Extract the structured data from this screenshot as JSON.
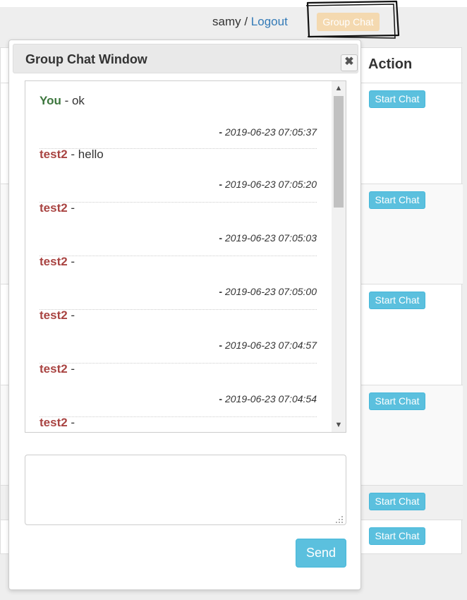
{
  "header": {
    "username": "samy",
    "separator": " / ",
    "logout_label": "Logout",
    "group_chat_label": "Group Chat"
  },
  "table": {
    "action_header": "Action",
    "start_chat_label": "Start Chat"
  },
  "dialog": {
    "title": "Group Chat Window",
    "close_icon": "close-icon",
    "messages": [
      {
        "sender": "You",
        "text": "ok",
        "time": "2019-06-23 07:05:37"
      },
      {
        "sender": "test2",
        "text": "hello",
        "time": "2019-06-23 07:05:20"
      },
      {
        "sender": "test2",
        "text": "",
        "time": "2019-06-23 07:05:03"
      },
      {
        "sender": "test2",
        "text": "",
        "time": "2019-06-23 07:05:00"
      },
      {
        "sender": "test2",
        "text": "",
        "time": "2019-06-23 07:04:57"
      },
      {
        "sender": "test2",
        "text": "",
        "time": "2019-06-23 07:04:54"
      },
      {
        "sender": "test2",
        "text": "",
        "time": ""
      }
    ],
    "message_input_value": "",
    "send_label": "Send"
  },
  "colors": {
    "you": "#3c763d",
    "other": "#a94442",
    "info_button": "#5bc0de",
    "link": "#337ab7",
    "group_chat_button": "#f4d9b0"
  }
}
